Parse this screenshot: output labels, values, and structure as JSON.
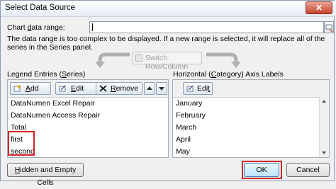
{
  "window": {
    "title": "Select Data Source"
  },
  "range": {
    "label_prefix": "Chart ",
    "label_accel": "d",
    "label_suffix": "ata range:",
    "value": ""
  },
  "info_text": "The data range is too complex to be displayed. If a new range is selected, it will replace all of the series in the Series panel.",
  "switch_button": {
    "label": "Switch Row/Column"
  },
  "legend": {
    "heading_prefix": "Legend Entries (",
    "heading_accel": "S",
    "heading_suffix": "eries)",
    "add_accel": "A",
    "add_rest": "dd",
    "edit_accel": "E",
    "edit_rest": "dit",
    "remove_accel": "R",
    "remove_rest": "emove",
    "items": [
      "DataNumen Excel Repair",
      "DataNumen Access Repair",
      "Total",
      "first",
      "second"
    ]
  },
  "category": {
    "heading_prefix": "Horizontal (",
    "heading_accel": "C",
    "heading_suffix": "ategory) Axis Labels",
    "edit_prefix": "Edi",
    "edit_accel": "t",
    "items": [
      "January",
      "February",
      "March",
      "April",
      "May"
    ]
  },
  "footer": {
    "hidden_accel": "H",
    "hidden_rest": "idden and Empty Cells",
    "ok_label": "OK",
    "cancel_label": "Cancel"
  },
  "colors": {
    "highlight": "#d2232a",
    "close_red": "#c7432b"
  },
  "icons": [
    "close-icon",
    "range-select-icon",
    "switch-icon",
    "add-series-icon",
    "edit-icon",
    "remove-icon",
    "move-up-icon",
    "move-down-icon"
  ]
}
